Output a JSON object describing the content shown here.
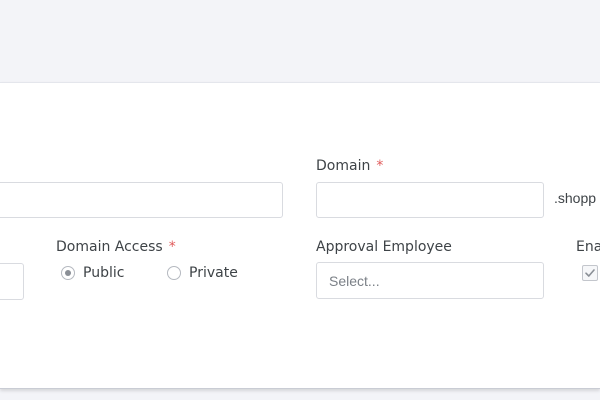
{
  "form": {
    "domain": {
      "label": "Domain",
      "required_mark": "*",
      "value": "",
      "suffix": ".shopp"
    },
    "domain_access": {
      "label": "Domain Access",
      "required_mark": "*",
      "options": [
        {
          "label": "Public",
          "selected": true
        },
        {
          "label": "Private",
          "selected": false
        }
      ]
    },
    "approval_employee": {
      "label": "Approval Employee",
      "placeholder": "Select..."
    },
    "enable": {
      "label": "Ena",
      "checked": true
    }
  },
  "colors": {
    "required": "#e05a5a",
    "border": "#d9dbe0",
    "page_background": "#f3f4f8"
  },
  "icons": {
    "radio_checked": "radio-checked-icon",
    "radio_unchecked": "radio-unchecked-icon",
    "checkbox_checked": "checkmark-icon"
  }
}
